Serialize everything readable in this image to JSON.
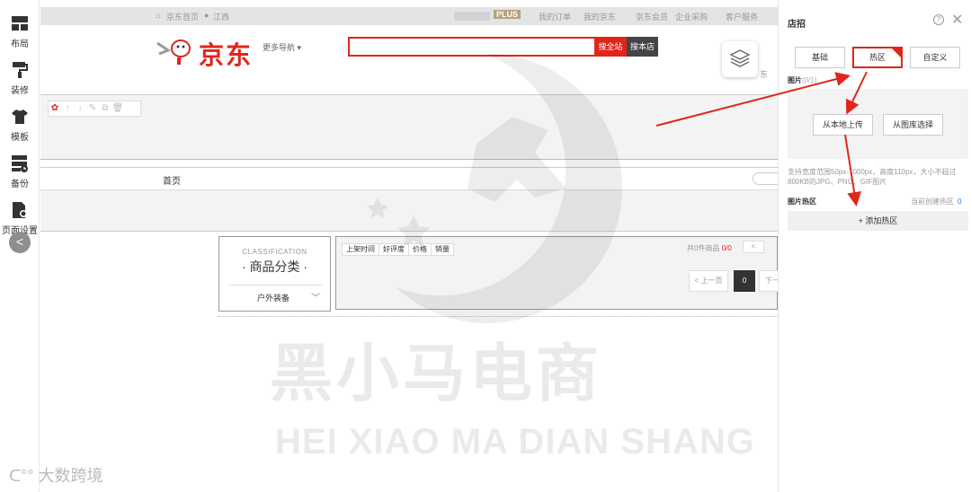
{
  "rail": {
    "items": [
      {
        "label": "布局",
        "icon": "layout-icon"
      },
      {
        "label": "装修",
        "icon": "paint-roller-icon"
      },
      {
        "label": "模板",
        "icon": "shirt-icon"
      },
      {
        "label": "备份",
        "icon": "backup-icon"
      },
      {
        "label": "页面设置",
        "icon": "page-settings-icon"
      }
    ],
    "collapse_glyph": "<"
  },
  "topbar": {
    "home": "京东首页",
    "location": "江西",
    "plus": "PLUS",
    "links": [
      "我的订单",
      "我的京东",
      "京东会员",
      "企业采购",
      "客户服务"
    ]
  },
  "header": {
    "logo_text": "京东",
    "more_nav": "更多导航 ▾",
    "search_placeholder": "",
    "search_all": "搜全站",
    "search_shop": "搜本店",
    "right_text": "东"
  },
  "navbar": {
    "home": "首页"
  },
  "mini_toolbar": [
    "✿",
    "↑",
    "↓",
    "✎",
    "⧉",
    "🗑"
  ],
  "category": {
    "en": "CLASSIFICATION",
    "cn": "· 商品分类 ·",
    "item": "户外装备",
    "chevron": "﹀"
  },
  "listing": {
    "sorts": [
      "上架时间",
      "好评度",
      "价格",
      "销量"
    ],
    "count_label": "共0件商品",
    "page_ratio": "0/0",
    "prev_small": "<",
    "prev": "< 上一页",
    "current": "0",
    "next": "下一"
  },
  "panel": {
    "title": "店招",
    "help": "?",
    "close": "✕",
    "tabs": [
      {
        "label": "基础",
        "active": false
      },
      {
        "label": "热区",
        "active": true
      },
      {
        "label": "自定义",
        "active": false
      }
    ],
    "image_label": "图片",
    "image_hint": "(0/1)",
    "upload_local": "从本地上传",
    "upload_library": "从图库选择",
    "note": "支持宽度范围50px-1000px，高度110px，大小不超过800KB的JPG、PNG、GIF图片",
    "hotzone_label": "图片热区",
    "hotzone_count_label": "当前创建热区",
    "hotzone_count": "0",
    "add_hotzone": "+ 添加热区"
  },
  "watermark": {
    "cn": "黑小马电商",
    "en": "HEI XIAO MA DIAN SHANG",
    "brand": "大数跨境"
  },
  "colors": {
    "jd_red": "#e1251b",
    "arrow_red": "#e1251b",
    "link_blue": "#1a7cf4"
  }
}
